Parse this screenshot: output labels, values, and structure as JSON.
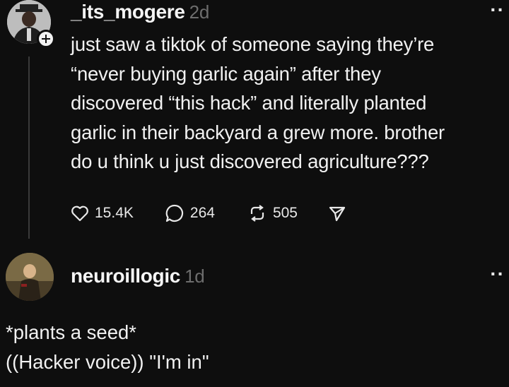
{
  "post": {
    "username": "_its_mogere",
    "time": "2d",
    "text_lines": [
      "just saw a tiktok of someone saying they’re",
      "“never buying garlic again” after they",
      "discovered “this hack” and literally planted",
      "garlic in their backyard a grew more. brother",
      "do u think u just discovered agriculture???"
    ],
    "likes": "15.4K",
    "replies": "264",
    "reposts": "505"
  },
  "reply": {
    "username": "neuroillogic",
    "time": "1d",
    "text_lines": [
      "*plants a seed*",
      "((Hacker voice)) \"I'm in\""
    ]
  },
  "icons": {
    "more": "more-options-icon",
    "like": "heart-icon",
    "reply": "comment-icon",
    "repost": "repost-icon",
    "share": "send-icon",
    "follow": "plus-icon"
  }
}
